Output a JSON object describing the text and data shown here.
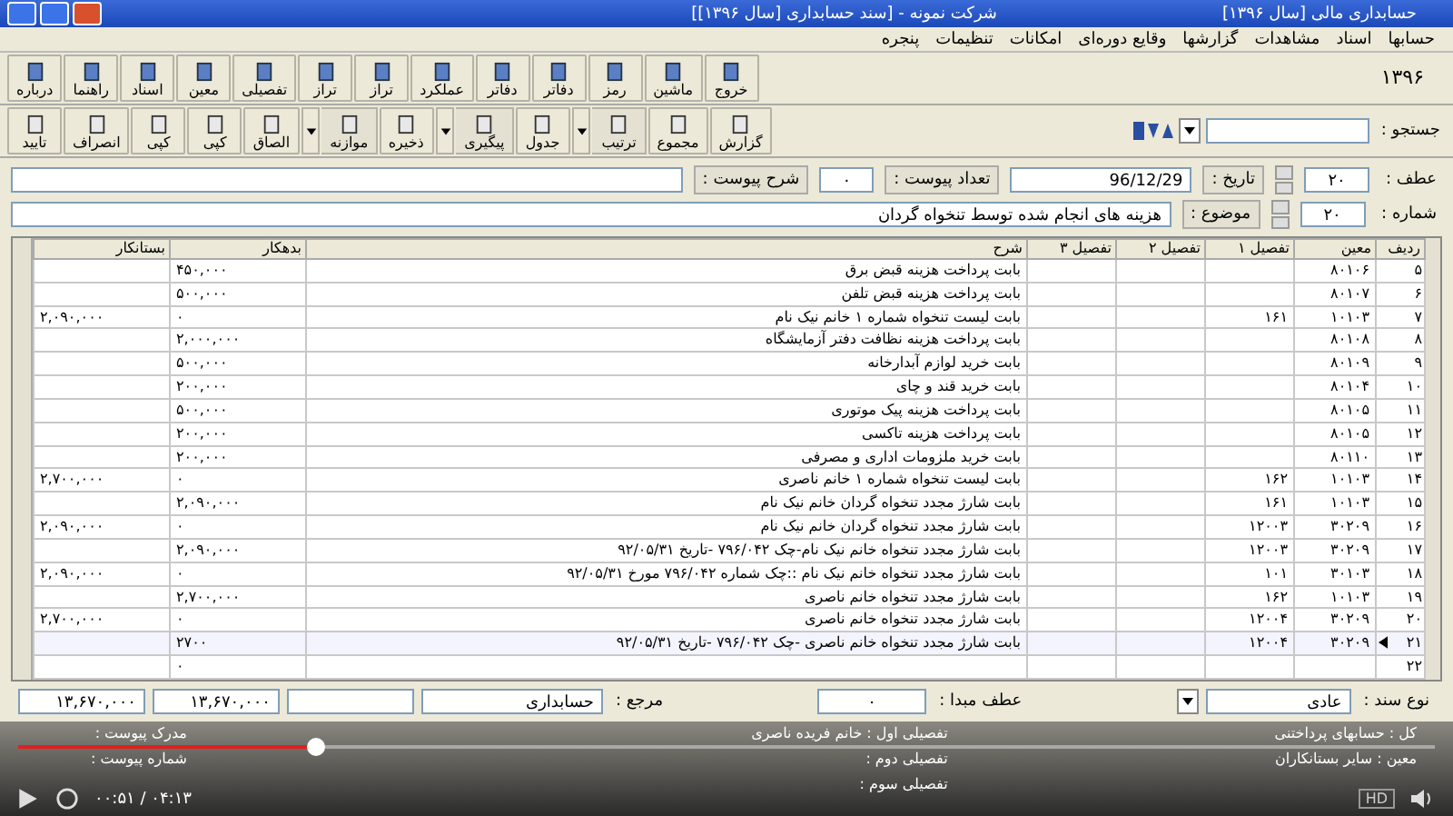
{
  "window": {
    "app_title": "حسابداری مالی [سال ۱۳۹۶]",
    "doc_title": "شرکت نمونه - [سند حسابداری [سال ۱۳۹۶]]"
  },
  "menu": [
    "حسابها",
    "اسناد",
    "مشاهدات",
    "گزارشها",
    "وقایع دوره‌ای",
    "امکانات",
    "تنظیمات",
    "پنجره"
  ],
  "toolbar_main": {
    "year": "۱۳۹۶",
    "buttons": [
      "خروج",
      "ماشین",
      "رمز",
      "دفاتر",
      "دفاتر",
      "عملکرد",
      "تراز",
      "تراز",
      "تفصیلی",
      "معین",
      "اسناد",
      "راهنما",
      "درباره"
    ]
  },
  "toolbar_doc": {
    "buttons": [
      {
        "label": "گزارش",
        "menu": false
      },
      {
        "label": "مجموع",
        "menu": false
      },
      {
        "label": "ترتیب",
        "menu": true
      },
      {
        "label": "جدول",
        "menu": false
      },
      {
        "label": "پیگیری",
        "menu": true
      },
      {
        "label": "ذخیره",
        "menu": false
      },
      {
        "label": "موازنه",
        "menu": true
      },
      {
        "label": "الصاق",
        "menu": false
      },
      {
        "label": "کپی",
        "menu": false
      },
      {
        "label": "کپی",
        "menu": false
      },
      {
        "label": "انصراف",
        "menu": false
      },
      {
        "label": "تایید",
        "menu": false
      }
    ],
    "search_label": "جستجو :"
  },
  "form": {
    "ref_label": "عطف :",
    "ref": "۲۰",
    "date_label": "تاریخ :",
    "date": "96/12/29",
    "attach_count_label": "تعداد پیوست :",
    "attach_count": "۰",
    "attach_desc_label": "شرح پیوست :",
    "number_label": "شماره :",
    "number": "۲۰",
    "subject_label": "موضوع :",
    "subject": "هزینه های انجام شده توسط تنخواه گردان"
  },
  "table": {
    "columns": [
      "ردیف",
      "معین",
      "تفصیل ۱",
      "تفصیل ۲",
      "تفصیل ۳",
      "شرح",
      "بدهکار",
      "بستانکار"
    ],
    "rows": [
      {
        "cells": [
          "۵",
          "۸۰۱۰۶",
          "",
          "",
          "",
          "بابت پرداخت هزینه قبض برق",
          "۴۵۰,۰۰۰",
          ""
        ],
        "selected": false
      },
      {
        "cells": [
          "۶",
          "۸۰۱۰۷",
          "",
          "",
          "",
          "بابت پرداخت هزینه قبض تلفن",
          "۵۰۰,۰۰۰",
          ""
        ],
        "selected": false
      },
      {
        "cells": [
          "۷",
          "۱۰۱۰۳",
          "۱۶۱",
          "",
          "",
          "بابت لیست تنخواه شماره ۱ خانم نیک نام",
          "۰",
          "۲,۰۹۰,۰۰۰"
        ],
        "selected": false
      },
      {
        "cells": [
          "۸",
          "۸۰۱۰۸",
          "",
          "",
          "",
          "بابت پرداخت هزینه نظافت دفتر آزمایشگاه",
          "۲,۰۰۰,۰۰۰",
          ""
        ],
        "selected": false
      },
      {
        "cells": [
          "۹",
          "۸۰۱۰۹",
          "",
          "",
          "",
          "بابت خرید لوازم آبدارخانه",
          "۵۰۰,۰۰۰",
          ""
        ],
        "selected": false
      },
      {
        "cells": [
          "۱۰",
          "۸۰۱۰۴",
          "",
          "",
          "",
          "بابت خرید قند و چای",
          "۲۰۰,۰۰۰",
          ""
        ],
        "selected": false
      },
      {
        "cells": [
          "۱۱",
          "۸۰۱۰۵",
          "",
          "",
          "",
          "بابت پرداخت هزینه پیک موتوری",
          "۵۰۰,۰۰۰",
          ""
        ],
        "selected": false
      },
      {
        "cells": [
          "۱۲",
          "۸۰۱۰۵",
          "",
          "",
          "",
          "بابت پرداخت هزینه تاکسی",
          "۲۰۰,۰۰۰",
          ""
        ],
        "selected": false
      },
      {
        "cells": [
          "۱۳",
          "۸۰۱۱۰",
          "",
          "",
          "",
          "بابت خرید ملزومات اداری و مصرفی",
          "۲۰۰,۰۰۰",
          ""
        ],
        "selected": false
      },
      {
        "cells": [
          "۱۴",
          "۱۰۱۰۳",
          "۱۶۲",
          "",
          "",
          "بابت لیست تنخواه شماره ۱ خانم ناصری",
          "۰",
          "۲,۷۰۰,۰۰۰"
        ],
        "selected": false
      },
      {
        "cells": [
          "۱۵",
          "۱۰۱۰۳",
          "۱۶۱",
          "",
          "",
          "بابت شارژ مجدد تنخواه گردان خانم نیک نام",
          "۲,۰۹۰,۰۰۰",
          ""
        ],
        "selected": false
      },
      {
        "cells": [
          "۱۶",
          "۳۰۲۰۹",
          "۱۲۰۰۳",
          "",
          "",
          "بابت شارژ مجدد تنخواه گردان خانم نیک نام",
          "۰",
          "۲,۰۹۰,۰۰۰"
        ],
        "selected": false
      },
      {
        "cells": [
          "۱۷",
          "۳۰۲۰۹",
          "۱۲۰۰۳",
          "",
          "",
          "بابت شارژ مجدد تنخواه خانم نیک نام-چک ۷۹۶/۰۴۲ -تاریخ ۹۲/۰۵/۳۱",
          "۲,۰۹۰,۰۰۰",
          ""
        ],
        "selected": false
      },
      {
        "cells": [
          "۱۸",
          "۳۰۱۰۳",
          "۱۰۱",
          "",
          "",
          "بابت شارژ مجدد تنخواه خانم نیک نام ::چک شماره ۷۹۶/۰۴۲ مورخ ۹۲/۰۵/۳۱",
          "۰",
          "۲,۰۹۰,۰۰۰"
        ],
        "selected": false
      },
      {
        "cells": [
          "۱۹",
          "۱۰۱۰۳",
          "۱۶۲",
          "",
          "",
          "بابت شارژ مجدد تنخواه خانم ناصری",
          "۲,۷۰۰,۰۰۰",
          ""
        ],
        "selected": false
      },
      {
        "cells": [
          "۲۰",
          "۳۰۲۰۹",
          "۱۲۰۰۴",
          "",
          "",
          "بابت شارژ مجدد تنخواه خانم ناصری",
          "۰",
          "۲,۷۰۰,۰۰۰"
        ],
        "selected": false
      },
      {
        "cells": [
          "۲۱",
          "۳۰۲۰۹",
          "۱۲۰۰۴",
          "",
          "",
          "بابت شارژ مجدد تنخواه خانم ناصری -چک ۷۹۶/۰۴۲ -تاریخ ۹۲/۰۵/۳۱",
          "۲۷۰۰",
          ""
        ],
        "selected": true
      },
      {
        "cells": [
          "۲۲",
          "",
          "",
          "",
          "",
          "",
          "۰",
          ""
        ],
        "selected": false
      }
    ]
  },
  "footer": {
    "type_label": "نوع سند :",
    "type": "عادی",
    "origin_ref_label": "عطف مبدا :",
    "origin_ref": "۰",
    "source_label": "مرجع :",
    "source": "حسابداری",
    "total_debit": "۱۳,۶۷۰,۰۰۰",
    "total_credit": "۱۳,۶۷۰,۰۰۰"
  },
  "details": {
    "general": "کل : حسابهای پرداختنی",
    "subsidiary": "معین : سایر بستانکاران",
    "detail_1": "تفصیلی اول : خانم  فریده ناصری",
    "detail_2": "تفصیلی دوم :",
    "detail_3": "تفصیلی سوم :",
    "attach_doc": "مدرک پیوست :",
    "attach_no": "شماره پیوست :"
  },
  "player": {
    "level": 0.21,
    "time": "۰۰:۵۱ / ۰۴:۱۳",
    "quality": "HD"
  }
}
